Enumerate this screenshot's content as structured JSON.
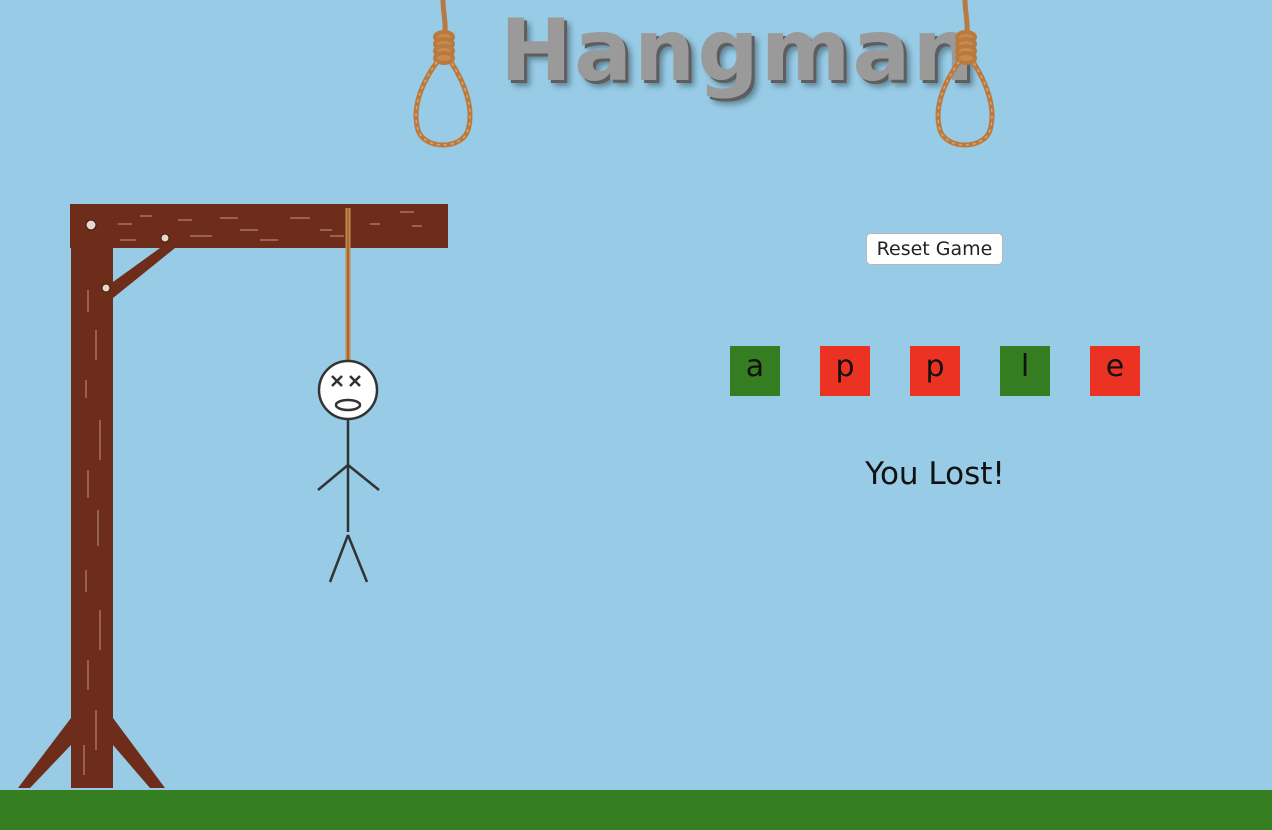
{
  "game": {
    "title": "Hangman",
    "reset_label": "Reset Game",
    "status": "You Lost!",
    "word_tiles": [
      {
        "letter": "a",
        "color": "#347d21",
        "state": "guessed"
      },
      {
        "letter": "p",
        "color": "#ec3323",
        "state": "missed"
      },
      {
        "letter": "p",
        "color": "#ec3323",
        "state": "missed"
      },
      {
        "letter": "l",
        "color": "#347d21",
        "state": "guessed"
      },
      {
        "letter": "e",
        "color": "#ec3323",
        "state": "missed"
      }
    ]
  },
  "colors": {
    "sky": "#97cbe6",
    "ground": "#357e21",
    "wood": "#6e2c1a",
    "rope": "#c98a4b",
    "correct": "#347d21",
    "wrong": "#ec3323"
  },
  "icons": {
    "noose": "noose-icon",
    "gallows": "gallows-icon",
    "hanged_figure": "stick-figure-icon"
  }
}
